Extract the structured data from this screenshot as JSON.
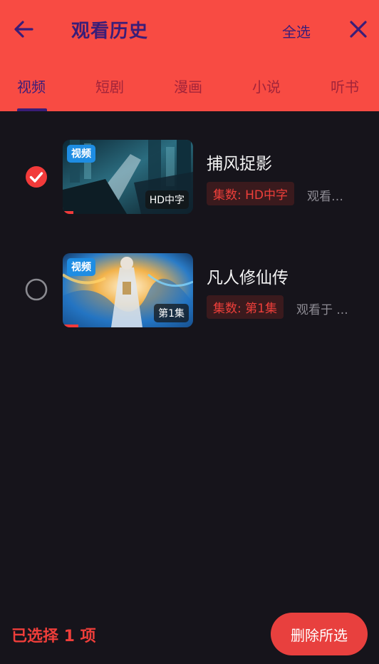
{
  "header": {
    "title": "观看历史",
    "select_all_label": "全选",
    "back_icon": "arrow-left-icon",
    "close_icon": "close-icon"
  },
  "tabs": [
    {
      "label": "视频",
      "active": true
    },
    {
      "label": "短剧",
      "active": false
    },
    {
      "label": "漫画",
      "active": false
    },
    {
      "label": "小说",
      "active": false
    },
    {
      "label": "听书",
      "active": false
    }
  ],
  "items": [
    {
      "title": "捕风捉影",
      "type_badge": "视频",
      "episode_overlay": "HD中字",
      "episode_tag": "集数: HD中字",
      "watched_text": "观看…",
      "selected": true,
      "progress": 0.08
    },
    {
      "title": "凡人修仙传",
      "type_badge": "视频",
      "episode_overlay": "第1集",
      "episode_tag": "集数: 第1集",
      "watched_text": "观看于 ...",
      "selected": false,
      "progress": 0.12
    }
  ],
  "footer": {
    "selected_count_text": "已选择 1 项",
    "delete_button_label": "删除所选"
  },
  "colors": {
    "accent": "#f84b43",
    "header_text": "#3a1d78",
    "background": "#16141b",
    "badge_blue": "#1e8de3"
  }
}
